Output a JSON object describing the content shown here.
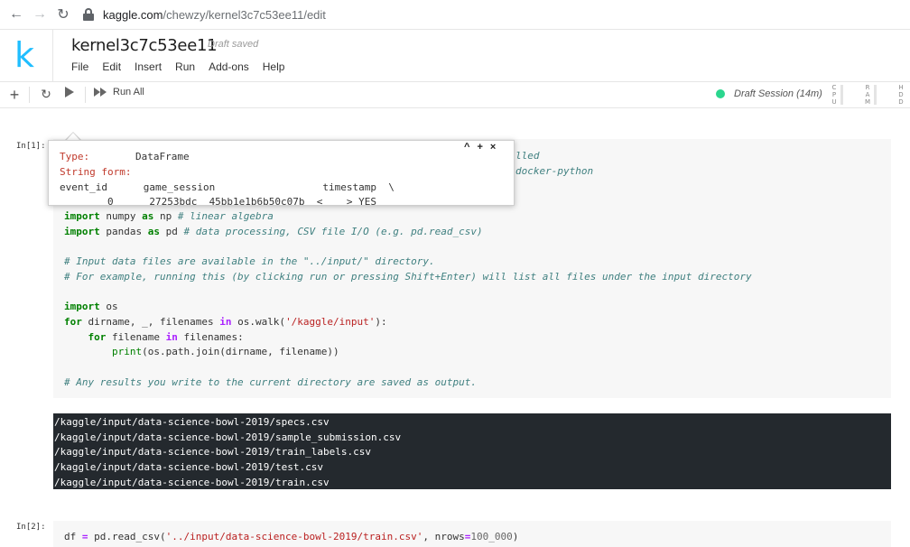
{
  "browser": {
    "url_host": "kaggle.com",
    "url_path": "/chewzy/kernel3c7c53ee11/edit"
  },
  "header": {
    "logo": "k",
    "kernel_title": "kernel3c7c53ee11",
    "save_status": "Draft saved",
    "menu": [
      "File",
      "Edit",
      "Insert",
      "Run",
      "Add-ons",
      "Help"
    ]
  },
  "toolbar": {
    "run_all_label": "Run All",
    "session_label": "Draft Session (14m)",
    "session_color": "#2bd68e",
    "meters": [
      {
        "label": "CPU",
        "letters": [
          "C",
          "P",
          "U"
        ]
      },
      {
        "label": "RAM",
        "letters": [
          "R",
          "A",
          "M"
        ]
      },
      {
        "label": "HDD",
        "letters": [
          "H",
          "D",
          "D"
        ]
      }
    ]
  },
  "cells": [
    {
      "prompt": "In[1]:",
      "partial_lines": [
        "lled",
        "docker-python"
      ],
      "output_lines": [
        "/kaggle/input/data-science-bowl-2019/specs.csv",
        "/kaggle/input/data-science-bowl-2019/sample_submission.csv",
        "/kaggle/input/data-science-bowl-2019/train_labels.csv",
        "/kaggle/input/data-science-bowl-2019/test.csv",
        "/kaggle/input/data-science-bowl-2019/train.csv"
      ]
    },
    {
      "prompt": "In[2]:"
    }
  ],
  "tooltip": {
    "type_key": "Type:",
    "type_val": "DataFrame",
    "string_form_key": "String form:",
    "row3": "event_id      game_session                  timestamp  \\",
    "row4": "        0      27253bdc  45bb1e1b6b50c07b  <    > YES",
    "controls": [
      "^",
      "+",
      "×"
    ]
  }
}
